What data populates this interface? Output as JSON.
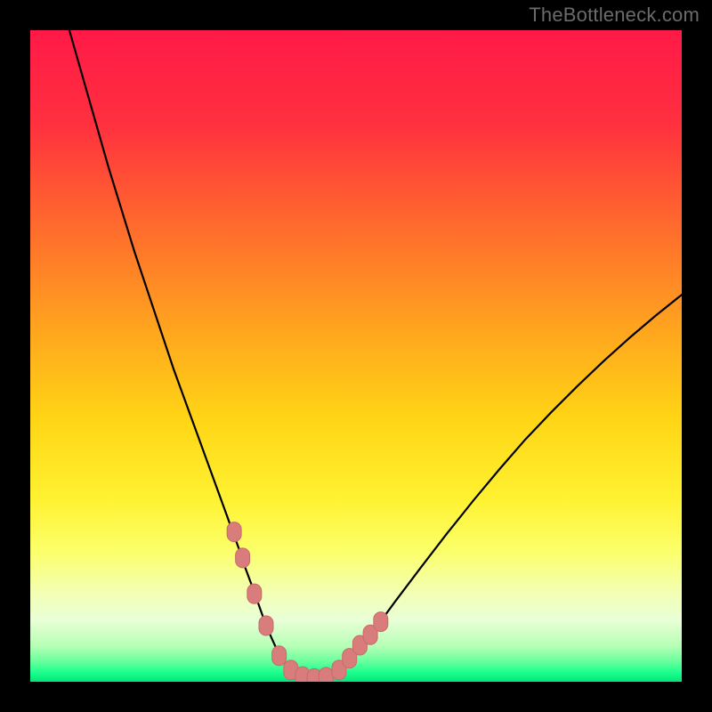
{
  "watermark": "TheBottleneck.com",
  "colors": {
    "frame": "#000000",
    "watermark": "#6b6b6b",
    "gradient_stops": [
      {
        "offset": 0.0,
        "color": "#ff1a47"
      },
      {
        "offset": 0.14,
        "color": "#ff2f3f"
      },
      {
        "offset": 0.3,
        "color": "#ff6a2d"
      },
      {
        "offset": 0.46,
        "color": "#ffa51e"
      },
      {
        "offset": 0.6,
        "color": "#ffd615"
      },
      {
        "offset": 0.72,
        "color": "#fff232"
      },
      {
        "offset": 0.8,
        "color": "#fbff6a"
      },
      {
        "offset": 0.86,
        "color": "#f3ffb0"
      },
      {
        "offset": 0.905,
        "color": "#e9ffd6"
      },
      {
        "offset": 0.945,
        "color": "#b6ffb6"
      },
      {
        "offset": 0.968,
        "color": "#6cff9e"
      },
      {
        "offset": 0.985,
        "color": "#1eff8e"
      },
      {
        "offset": 1.0,
        "color": "#00e878"
      }
    ],
    "curve": "#000000",
    "marker_fill": "#d97c7c",
    "marker_stroke": "#c96a6a"
  },
  "chart_data": {
    "type": "line",
    "title": "",
    "xlabel": "",
    "ylabel": "",
    "xlim": [
      0,
      100
    ],
    "ylim": [
      0,
      100
    ],
    "series": [
      {
        "name": "bottleneck-curve",
        "x": [
          6,
          8,
          10,
          12,
          14,
          16,
          18,
          20,
          22,
          24,
          26,
          28,
          30,
          32,
          33,
          34,
          35,
          36,
          37,
          38,
          39,
          40,
          41,
          42,
          43,
          44,
          45,
          46,
          48,
          50,
          53,
          56,
          60,
          64,
          68,
          72,
          76,
          80,
          84,
          88,
          92,
          96,
          100
        ],
        "y": [
          100,
          93,
          86,
          79,
          72.5,
          66,
          60,
          54,
          48,
          42.5,
          37,
          31.5,
          26,
          20.5,
          17.5,
          14.8,
          12,
          9.2,
          6.8,
          4.6,
          3.0,
          1.8,
          1.0,
          0.6,
          0.5,
          0.5,
          0.6,
          1.0,
          2.4,
          4.4,
          8.2,
          12.3,
          17.6,
          22.8,
          27.8,
          32.6,
          37.2,
          41.4,
          45.4,
          49.2,
          52.8,
          56.2,
          59.4
        ]
      }
    ],
    "markers": {
      "name": "highlight-points",
      "x": [
        31.3,
        32.6,
        34.4,
        36.2,
        38.2,
        40.0,
        41.8,
        43.6,
        45.4,
        47.4,
        49.0,
        50.6,
        52.2,
        53.8
      ],
      "y": [
        23.0,
        19.0,
        13.5,
        8.6,
        4.0,
        1.8,
        0.8,
        0.5,
        0.7,
        1.8,
        3.6,
        5.6,
        7.2,
        9.2
      ]
    }
  }
}
